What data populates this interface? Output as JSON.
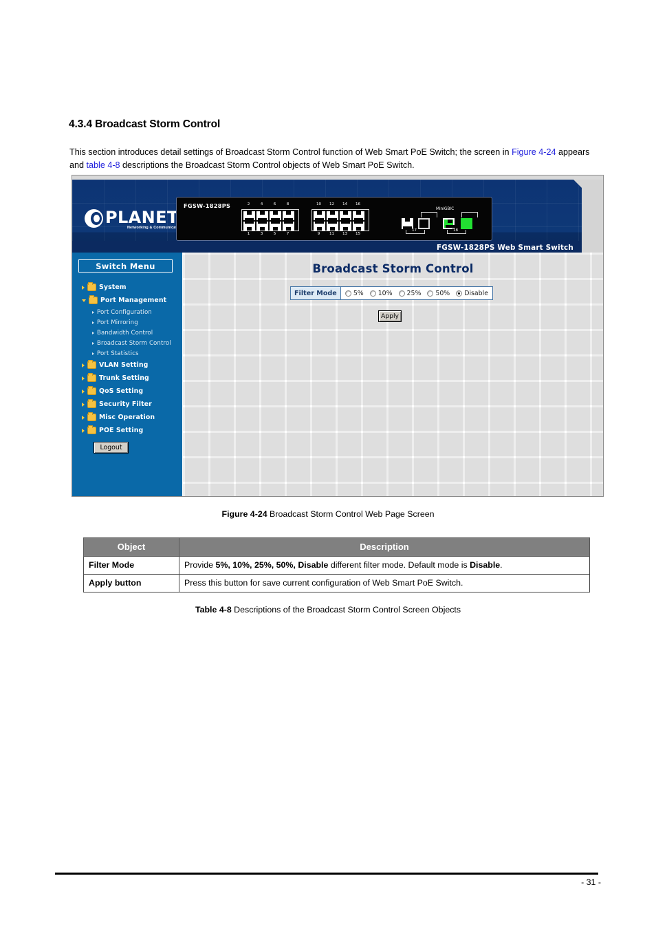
{
  "document": {
    "section_heading": "4.3.4 Broadcast Storm Control",
    "intro_part1": "This section introduces detail settings of Broadcast Storm Control function of Web Smart PoE Switch; the screen in ",
    "intro_xref1": "Figure 4-24",
    "intro_part2": " appears and ",
    "intro_xref2": "table 4-8",
    "intro_part3": " descriptions the Broadcast Storm Control objects of Web Smart PoE Switch.",
    "figure_caption_label": "Figure 4-24",
    "figure_caption_text": " Broadcast Storm Control Web Page Screen",
    "table_caption_label": "Table 4-8",
    "table_caption_text": " Descriptions of the Broadcast Storm Control Screen Objects",
    "page_number": "- 31 -"
  },
  "figure": {
    "banner": {
      "brand": "PLANET",
      "tagline": "Networking & Communication",
      "device_model": "FGSW-1828PS",
      "gbic_label": "MiniGBIC",
      "ports_top": [
        "2",
        "4",
        "6",
        "8",
        "10",
        "12",
        "14",
        "16"
      ],
      "ports_bottom": [
        "1",
        "3",
        "5",
        "7",
        "9",
        "11",
        "13",
        "15"
      ],
      "uplink_labels": [
        "17",
        "18"
      ],
      "title_bar": "FGSW-1828PS Web Smart Switch"
    },
    "sidebar": {
      "menu_button": "Switch Menu",
      "items": [
        {
          "label": "System",
          "type": "folder",
          "expanded": false
        },
        {
          "label": "Port Management",
          "type": "folder",
          "expanded": true
        },
        {
          "label": "Port Configuration",
          "type": "sub"
        },
        {
          "label": "Port Mirroring",
          "type": "sub"
        },
        {
          "label": "Bandwidth Control",
          "type": "sub"
        },
        {
          "label": "Broadcast Storm Control",
          "type": "sub"
        },
        {
          "label": "Port Statistics",
          "type": "sub"
        },
        {
          "label": "VLAN Setting",
          "type": "folder",
          "expanded": false
        },
        {
          "label": "Trunk Setting",
          "type": "folder",
          "expanded": false
        },
        {
          "label": "QoS Setting",
          "type": "folder",
          "expanded": false
        },
        {
          "label": "Security Filter",
          "type": "folder",
          "expanded": false
        },
        {
          "label": "Misc Operation",
          "type": "folder",
          "expanded": false
        },
        {
          "label": "POE Setting",
          "type": "folder",
          "expanded": false
        }
      ],
      "logout_label": "Logout"
    },
    "content": {
      "page_title": "Broadcast Storm Control",
      "filter_mode_label": "Filter Mode",
      "filter_options": [
        {
          "label": "5%",
          "checked": false
        },
        {
          "label": "10%",
          "checked": false
        },
        {
          "label": "25%",
          "checked": false
        },
        {
          "label": "50%",
          "checked": false
        },
        {
          "label": "Disable",
          "checked": true
        }
      ],
      "apply_label": "Apply"
    }
  },
  "object_table": {
    "headers": [
      "Object",
      "Description"
    ],
    "rows": [
      {
        "object": "Filter Mode",
        "desc_pre": "Provide ",
        "desc_b1": "5%, 10%, 25%, 50%, Disable",
        "desc_mid": " different filter mode. Default mode is ",
        "desc_b2": "Disable",
        "desc_post": "."
      },
      {
        "object": "Apply button",
        "desc_pre": "Press this button for save current configuration of Web Smart PoE Switch.",
        "desc_b1": "",
        "desc_mid": "",
        "desc_b2": "",
        "desc_post": ""
      }
    ]
  },
  "colors": {
    "banner_navy": "#0d3474",
    "sidebar_blue": "#0a69a8",
    "title_navy": "#0d2c66",
    "xref_blue": "#2222dd",
    "table_header_gray": "#808080",
    "led_green": "#22e032",
    "folder_gold": "#f5c242"
  }
}
